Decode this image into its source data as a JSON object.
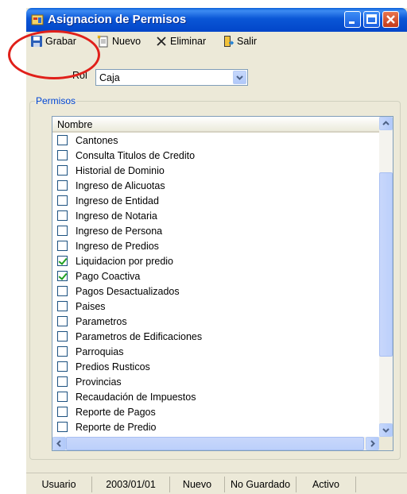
{
  "window": {
    "title": "Asignacion de Permisos",
    "controls": [
      "minimize-icon",
      "maximize-icon",
      "close-icon"
    ]
  },
  "toolbar": {
    "grabar": {
      "label": "Grabar",
      "icon": "save-icon"
    },
    "nuevo": {
      "label": "Nuevo",
      "icon": "new-document-icon"
    },
    "eliminar": {
      "label": "Eliminar",
      "icon": "delete-x-icon"
    },
    "salir": {
      "label": "Salir",
      "icon": "exit-door-icon"
    }
  },
  "rol": {
    "label": "Rol",
    "value": "Caja"
  },
  "permisos": {
    "group_label": "Permisos",
    "column_header": "Nombre",
    "items": [
      {
        "label": "Cantones",
        "checked": false
      },
      {
        "label": "Consulta Titulos de Credito",
        "checked": false
      },
      {
        "label": "Historial de Dominio",
        "checked": false
      },
      {
        "label": "Ingreso de Alicuotas",
        "checked": false
      },
      {
        "label": "Ingreso de Entidad",
        "checked": false
      },
      {
        "label": "Ingreso de Notaria",
        "checked": false
      },
      {
        "label": "Ingreso de Persona",
        "checked": false
      },
      {
        "label": "Ingreso de Predios",
        "checked": false
      },
      {
        "label": "Liquidacion por predio",
        "checked": true
      },
      {
        "label": "Pago Coactiva",
        "checked": true
      },
      {
        "label": "Pagos Desactualizados",
        "checked": false
      },
      {
        "label": "Paises",
        "checked": false
      },
      {
        "label": "Parametros",
        "checked": false
      },
      {
        "label": "Parametros de Edificaciones",
        "checked": false
      },
      {
        "label": "Parroquias",
        "checked": false
      },
      {
        "label": "Predios Rusticos",
        "checked": false
      },
      {
        "label": "Provincias",
        "checked": false
      },
      {
        "label": "Recaudación de Impuestos",
        "checked": false
      },
      {
        "label": "Reporte de Pagos",
        "checked": false
      },
      {
        "label": "Reporte de Predio",
        "checked": false
      }
    ]
  },
  "statusbar": {
    "usuario": "Usuario",
    "fecha": "2003/01/01",
    "modo": "Nuevo",
    "guardado": "No Guardado",
    "estado": "Activo"
  },
  "colors": {
    "titlebar": "#0a56d6",
    "annotation": "#e0201a",
    "group_label": "#0046d5"
  }
}
